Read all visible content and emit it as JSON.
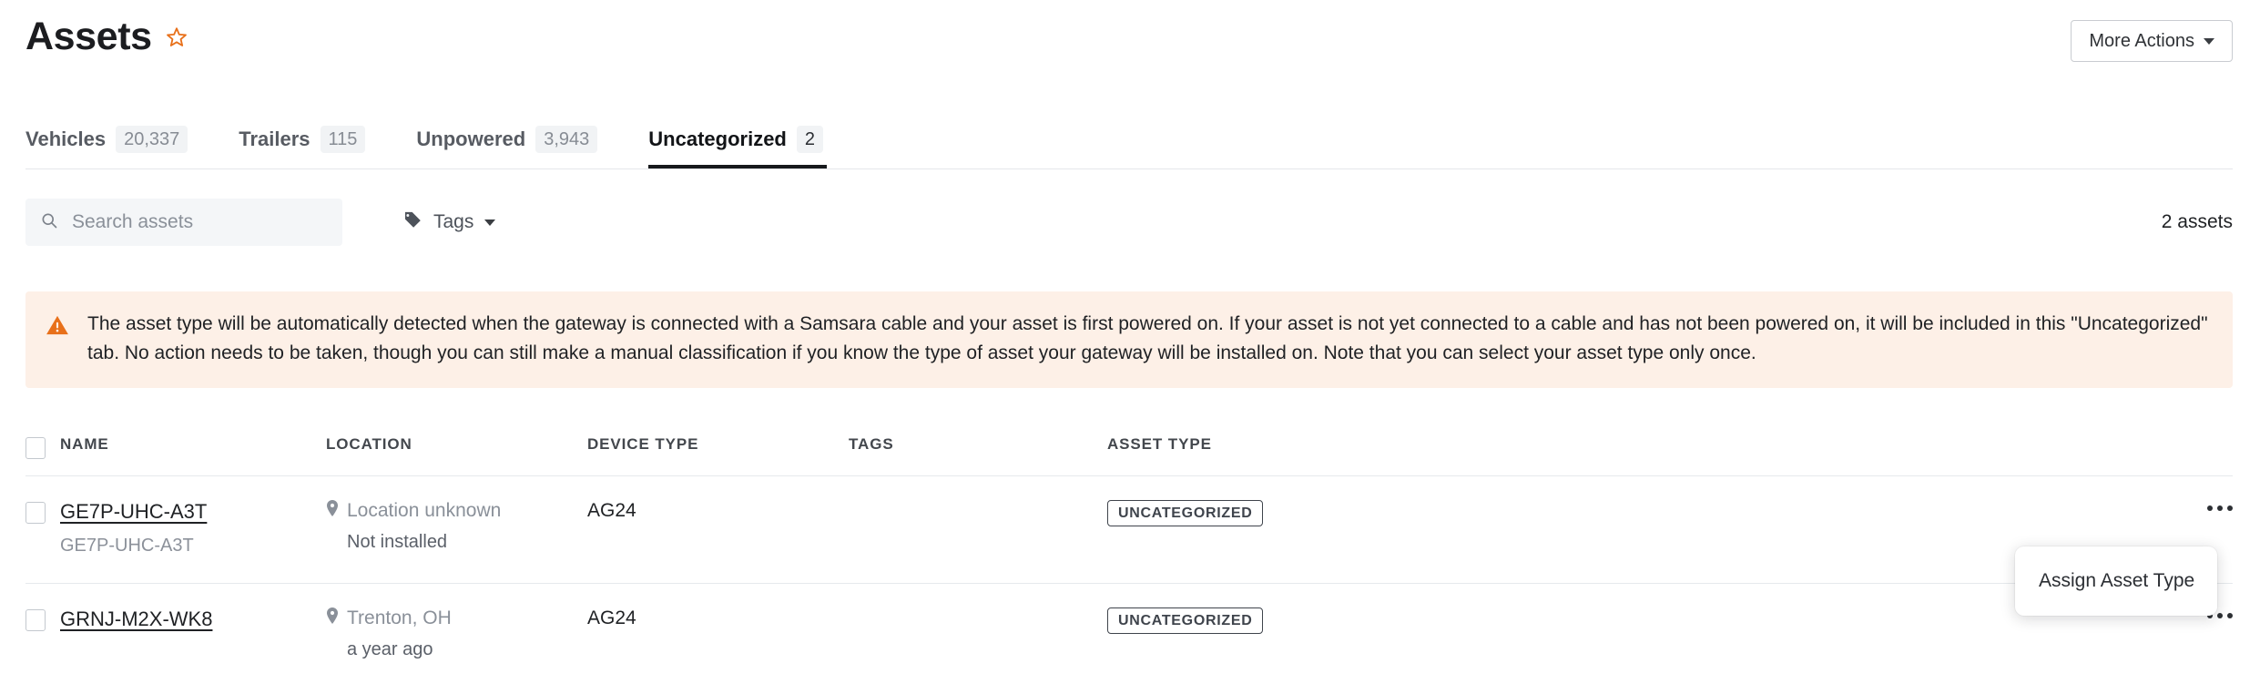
{
  "header": {
    "title": "Assets",
    "favorite_icon": "star-icon",
    "more_actions_label": "More Actions"
  },
  "tabs": [
    {
      "label": "Vehicles",
      "count": "20,337",
      "active": false
    },
    {
      "label": "Trailers",
      "count": "115",
      "active": false
    },
    {
      "label": "Unpowered",
      "count": "3,943",
      "active": false
    },
    {
      "label": "Uncategorized",
      "count": "2",
      "active": true
    }
  ],
  "filters": {
    "search_placeholder": "Search assets",
    "search_value": "",
    "search_icon": "search-icon",
    "tags_label": "Tags",
    "tags_icon": "tag-icon",
    "assets_count_label": "2 assets"
  },
  "banner": {
    "icon": "warning-triangle-icon",
    "text": "The asset type will be automatically detected when the gateway is connected with a Samsara cable and your asset is first powered on. If your asset is not yet connected to a cable and has not been powered on, it will be included in this \"Uncategorized\" tab. No action needs to be taken, though you can still make a manual classification if you know the type of asset your gateway will be installed on. Note that you can select your asset type only once.",
    "background_color": "#fdf0e7",
    "icon_color": "#e8701a"
  },
  "table": {
    "columns": [
      "NAME",
      "LOCATION",
      "DEVICE TYPE",
      "TAGS",
      "ASSET TYPE"
    ],
    "rows": [
      {
        "name": "GE7P-UHC-A3T",
        "name_sub": "GE7P-UHC-A3T",
        "location": "Location unknown",
        "location_sub": "Not installed",
        "device_type": "AG24",
        "tags": "",
        "asset_type": "UNCATEGORIZED"
      },
      {
        "name": "GRNJ-M2X-WK8",
        "name_sub": "",
        "location": "Trenton, OH",
        "location_sub": "a year ago",
        "device_type": "AG24",
        "tags": "",
        "asset_type": "UNCATEGORIZED"
      }
    ]
  },
  "dropdown": {
    "items": [
      "Assign Asset Type"
    ]
  },
  "colors": {
    "accent_orange": "#e8701a",
    "active_tab_underline": "#17191c",
    "badge_border": "#3f444c"
  }
}
